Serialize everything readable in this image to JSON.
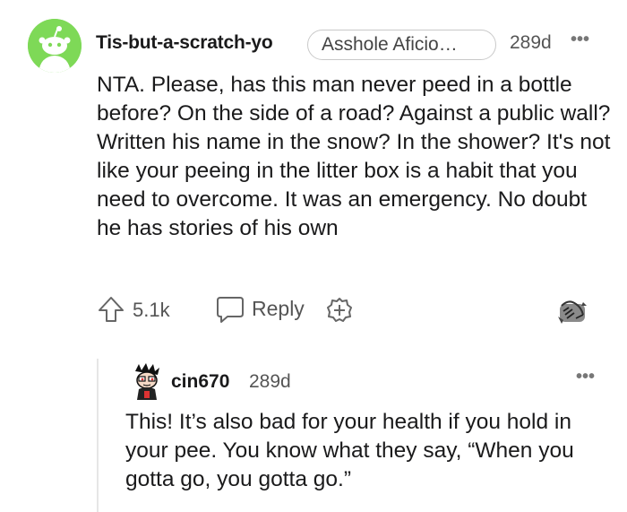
{
  "comment": {
    "username": "Tis-but-a-scratch-yo",
    "flair": "Asshole Aficio…",
    "timestamp": "289d",
    "more_label": "•••",
    "body": "NTA. Please, has this man never peed in a bottle before? On the side of a road? Against a public wall? Written his name in the snow? In the shower? It's not like your peeing in the litter box is a habit that you need to overcome. It was an emergency. No doubt he has stories of his own",
    "vote_count": "5.1k",
    "reply_label": "Reply",
    "avatar_color": "#7ed957"
  },
  "reply": {
    "username": "cin670",
    "timestamp": "289d",
    "more_label": "•••",
    "body": "This! It’s also bad for your health if you hold in your pee. You know what they say, “When you gotta go, you gotta go.”"
  },
  "icons": [
    "snoo-avatar-icon",
    "upvote-icon",
    "reply-bubble-icon",
    "award-plus-icon",
    "hands-icon",
    "cartoon-avatar-icon"
  ]
}
